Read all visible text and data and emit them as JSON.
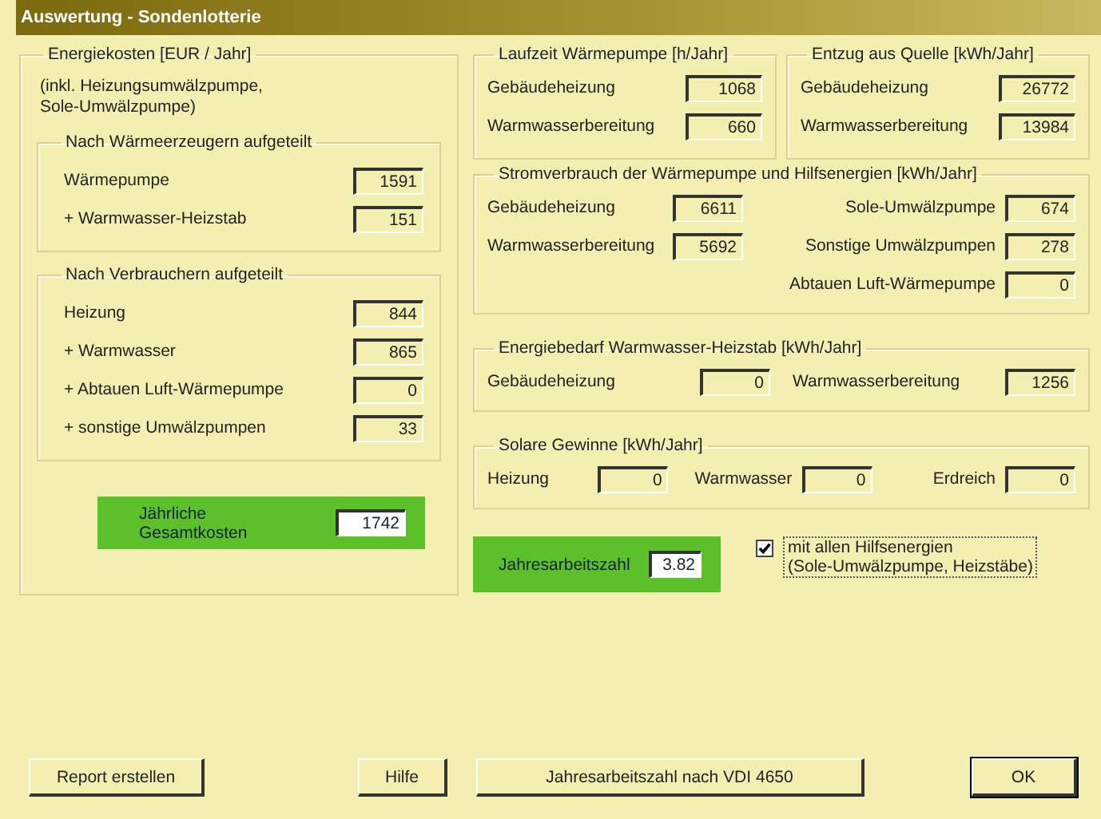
{
  "window": {
    "title": "Auswertung - Sondenlotterie"
  },
  "energy_costs": {
    "title": "Energiekosten [EUR / Jahr]",
    "note": "(inkl. Heizungsumwälzpumpe,\nSole-Umwälzpumpe)",
    "groups": [
      {
        "title": "Nach Wärmeerzeugern aufgeteilt",
        "rows": [
          {
            "label": "Wärmepumpe",
            "value": "1591"
          },
          {
            "label": "+ Warmwasser-Heizstab",
            "value": "151"
          }
        ]
      },
      {
        "title": "Nach Verbrauchern aufgeteilt",
        "rows": [
          {
            "label": "Heizung",
            "value": "844"
          },
          {
            "label": "+ Warmwasser",
            "value": "865"
          },
          {
            "label": "+ Abtauen Luft-Wärmepumpe",
            "value": "0"
          },
          {
            "label": "+ sonstige Umwälzpumpen",
            "value": "33"
          }
        ]
      }
    ],
    "total": {
      "label": "Jährliche Gesamtkosten",
      "value": "1742"
    }
  },
  "top_groups": [
    {
      "title": "Laufzeit Wärmepumpe [h/Jahr]",
      "rows": [
        {
          "label": "Gebäudeheizung",
          "value": "1068"
        },
        {
          "label": "Warmwasserbereitung",
          "value": "660"
        }
      ]
    },
    {
      "title": "Entzug aus Quelle [kWh/Jahr]",
      "rows": [
        {
          "label": "Gebäudeheizung",
          "value": "26772"
        },
        {
          "label": "Warmwasserbereitung",
          "value": "13984"
        }
      ]
    }
  ],
  "power": {
    "title": "Stromverbrauch der Wärmepumpe und Hilfsenergien [kWh/Jahr]",
    "left": [
      {
        "label": "Gebäudeheizung",
        "value": "6611"
      },
      {
        "label": "Warmwasserbereitung",
        "value": "5692"
      }
    ],
    "right": [
      {
        "label": "Sole-Umwälzpumpe",
        "value": "674"
      },
      {
        "label": "Sonstige Umwälzpumpen",
        "value": "278"
      },
      {
        "label": "Abtauen Luft-Wärmepumpe",
        "value": "0"
      }
    ]
  },
  "heater_demand": {
    "title": "Energiebedarf Warmwasser-Heizstab [kWh/Jahr]",
    "fields": [
      {
        "label": "Gebäudeheizung",
        "value": "0"
      },
      {
        "label": "Warmwasserbereitung",
        "value": "1256"
      }
    ]
  },
  "solar": {
    "title": "Solare Gewinne [kWh/Jahr]",
    "fields": [
      {
        "label": "Heizung",
        "value": "0"
      },
      {
        "label": "Warmwasser",
        "value": "0"
      },
      {
        "label": "Erdreich",
        "value": "0"
      }
    ]
  },
  "jaz": {
    "label": "Jahresarbeitszahl",
    "value": "3.82"
  },
  "aux_checkbox": {
    "label": "mit allen Hilfsenergien\n(Sole-Umwälzpumpe, Heizstäbe)",
    "checked": true
  },
  "buttons": [
    {
      "label": "Report erstellen",
      "default": false
    },
    {
      "label": "Hilfe",
      "default": false
    },
    {
      "label": "Jahresarbeitszahl nach VDI 4650",
      "default": false
    },
    {
      "label": "OK",
      "default": true
    }
  ]
}
